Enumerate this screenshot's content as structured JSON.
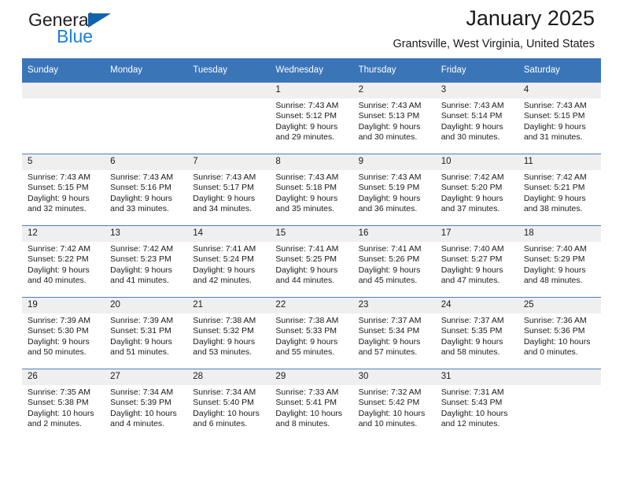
{
  "brand": {
    "name_top": "General",
    "name_bottom": "Blue",
    "accent_dark": "#1262ac",
    "accent_light": "#1b7fd4"
  },
  "header": {
    "title": "January 2025",
    "subtitle": "Grantsville, West Virginia, United States"
  },
  "theme": {
    "header_blue": "#3a75b8",
    "daynum_gray": "#efefef",
    "row_border": "#4a7fc1"
  },
  "labels": {
    "sunrise_prefix": "Sunrise:",
    "sunset_prefix": "Sunset:",
    "daylight_prefix": "Daylight:"
  },
  "weekdays": [
    "Sunday",
    "Monday",
    "Tuesday",
    "Wednesday",
    "Thursday",
    "Friday",
    "Saturday"
  ],
  "weeks": [
    [
      {
        "day": "",
        "empty": true
      },
      {
        "day": "",
        "empty": true
      },
      {
        "day": "",
        "empty": true
      },
      {
        "day": "1",
        "sunrise": "Sunrise: 7:43 AM",
        "sunset": "Sunset: 5:12 PM",
        "daylight_line1": "Daylight: 9 hours",
        "daylight_line2": "and 29 minutes."
      },
      {
        "day": "2",
        "sunrise": "Sunrise: 7:43 AM",
        "sunset": "Sunset: 5:13 PM",
        "daylight_line1": "Daylight: 9 hours",
        "daylight_line2": "and 30 minutes."
      },
      {
        "day": "3",
        "sunrise": "Sunrise: 7:43 AM",
        "sunset": "Sunset: 5:14 PM",
        "daylight_line1": "Daylight: 9 hours",
        "daylight_line2": "and 30 minutes."
      },
      {
        "day": "4",
        "sunrise": "Sunrise: 7:43 AM",
        "sunset": "Sunset: 5:15 PM",
        "daylight_line1": "Daylight: 9 hours",
        "daylight_line2": "and 31 minutes."
      }
    ],
    [
      {
        "day": "5",
        "sunrise": "Sunrise: 7:43 AM",
        "sunset": "Sunset: 5:15 PM",
        "daylight_line1": "Daylight: 9 hours",
        "daylight_line2": "and 32 minutes."
      },
      {
        "day": "6",
        "sunrise": "Sunrise: 7:43 AM",
        "sunset": "Sunset: 5:16 PM",
        "daylight_line1": "Daylight: 9 hours",
        "daylight_line2": "and 33 minutes."
      },
      {
        "day": "7",
        "sunrise": "Sunrise: 7:43 AM",
        "sunset": "Sunset: 5:17 PM",
        "daylight_line1": "Daylight: 9 hours",
        "daylight_line2": "and 34 minutes."
      },
      {
        "day": "8",
        "sunrise": "Sunrise: 7:43 AM",
        "sunset": "Sunset: 5:18 PM",
        "daylight_line1": "Daylight: 9 hours",
        "daylight_line2": "and 35 minutes."
      },
      {
        "day": "9",
        "sunrise": "Sunrise: 7:43 AM",
        "sunset": "Sunset: 5:19 PM",
        "daylight_line1": "Daylight: 9 hours",
        "daylight_line2": "and 36 minutes."
      },
      {
        "day": "10",
        "sunrise": "Sunrise: 7:42 AM",
        "sunset": "Sunset: 5:20 PM",
        "daylight_line1": "Daylight: 9 hours",
        "daylight_line2": "and 37 minutes."
      },
      {
        "day": "11",
        "sunrise": "Sunrise: 7:42 AM",
        "sunset": "Sunset: 5:21 PM",
        "daylight_line1": "Daylight: 9 hours",
        "daylight_line2": "and 38 minutes."
      }
    ],
    [
      {
        "day": "12",
        "sunrise": "Sunrise: 7:42 AM",
        "sunset": "Sunset: 5:22 PM",
        "daylight_line1": "Daylight: 9 hours",
        "daylight_line2": "and 40 minutes."
      },
      {
        "day": "13",
        "sunrise": "Sunrise: 7:42 AM",
        "sunset": "Sunset: 5:23 PM",
        "daylight_line1": "Daylight: 9 hours",
        "daylight_line2": "and 41 minutes."
      },
      {
        "day": "14",
        "sunrise": "Sunrise: 7:41 AM",
        "sunset": "Sunset: 5:24 PM",
        "daylight_line1": "Daylight: 9 hours",
        "daylight_line2": "and 42 minutes."
      },
      {
        "day": "15",
        "sunrise": "Sunrise: 7:41 AM",
        "sunset": "Sunset: 5:25 PM",
        "daylight_line1": "Daylight: 9 hours",
        "daylight_line2": "and 44 minutes."
      },
      {
        "day": "16",
        "sunrise": "Sunrise: 7:41 AM",
        "sunset": "Sunset: 5:26 PM",
        "daylight_line1": "Daylight: 9 hours",
        "daylight_line2": "and 45 minutes."
      },
      {
        "day": "17",
        "sunrise": "Sunrise: 7:40 AM",
        "sunset": "Sunset: 5:27 PM",
        "daylight_line1": "Daylight: 9 hours",
        "daylight_line2": "and 47 minutes."
      },
      {
        "day": "18",
        "sunrise": "Sunrise: 7:40 AM",
        "sunset": "Sunset: 5:29 PM",
        "daylight_line1": "Daylight: 9 hours",
        "daylight_line2": "and 48 minutes."
      }
    ],
    [
      {
        "day": "19",
        "sunrise": "Sunrise: 7:39 AM",
        "sunset": "Sunset: 5:30 PM",
        "daylight_line1": "Daylight: 9 hours",
        "daylight_line2": "and 50 minutes."
      },
      {
        "day": "20",
        "sunrise": "Sunrise: 7:39 AM",
        "sunset": "Sunset: 5:31 PM",
        "daylight_line1": "Daylight: 9 hours",
        "daylight_line2": "and 51 minutes."
      },
      {
        "day": "21",
        "sunrise": "Sunrise: 7:38 AM",
        "sunset": "Sunset: 5:32 PM",
        "daylight_line1": "Daylight: 9 hours",
        "daylight_line2": "and 53 minutes."
      },
      {
        "day": "22",
        "sunrise": "Sunrise: 7:38 AM",
        "sunset": "Sunset: 5:33 PM",
        "daylight_line1": "Daylight: 9 hours",
        "daylight_line2": "and 55 minutes."
      },
      {
        "day": "23",
        "sunrise": "Sunrise: 7:37 AM",
        "sunset": "Sunset: 5:34 PM",
        "daylight_line1": "Daylight: 9 hours",
        "daylight_line2": "and 57 minutes."
      },
      {
        "day": "24",
        "sunrise": "Sunrise: 7:37 AM",
        "sunset": "Sunset: 5:35 PM",
        "daylight_line1": "Daylight: 9 hours",
        "daylight_line2": "and 58 minutes."
      },
      {
        "day": "25",
        "sunrise": "Sunrise: 7:36 AM",
        "sunset": "Sunset: 5:36 PM",
        "daylight_line1": "Daylight: 10 hours",
        "daylight_line2": "and 0 minutes."
      }
    ],
    [
      {
        "day": "26",
        "sunrise": "Sunrise: 7:35 AM",
        "sunset": "Sunset: 5:38 PM",
        "daylight_line1": "Daylight: 10 hours",
        "daylight_line2": "and 2 minutes."
      },
      {
        "day": "27",
        "sunrise": "Sunrise: 7:34 AM",
        "sunset": "Sunset: 5:39 PM",
        "daylight_line1": "Daylight: 10 hours",
        "daylight_line2": "and 4 minutes."
      },
      {
        "day": "28",
        "sunrise": "Sunrise: 7:34 AM",
        "sunset": "Sunset: 5:40 PM",
        "daylight_line1": "Daylight: 10 hours",
        "daylight_line2": "and 6 minutes."
      },
      {
        "day": "29",
        "sunrise": "Sunrise: 7:33 AM",
        "sunset": "Sunset: 5:41 PM",
        "daylight_line1": "Daylight: 10 hours",
        "daylight_line2": "and 8 minutes."
      },
      {
        "day": "30",
        "sunrise": "Sunrise: 7:32 AM",
        "sunset": "Sunset: 5:42 PM",
        "daylight_line1": "Daylight: 10 hours",
        "daylight_line2": "and 10 minutes."
      },
      {
        "day": "31",
        "sunrise": "Sunrise: 7:31 AM",
        "sunset": "Sunset: 5:43 PM",
        "daylight_line1": "Daylight: 10 hours",
        "daylight_line2": "and 12 minutes."
      },
      {
        "day": "",
        "empty": true
      }
    ]
  ]
}
